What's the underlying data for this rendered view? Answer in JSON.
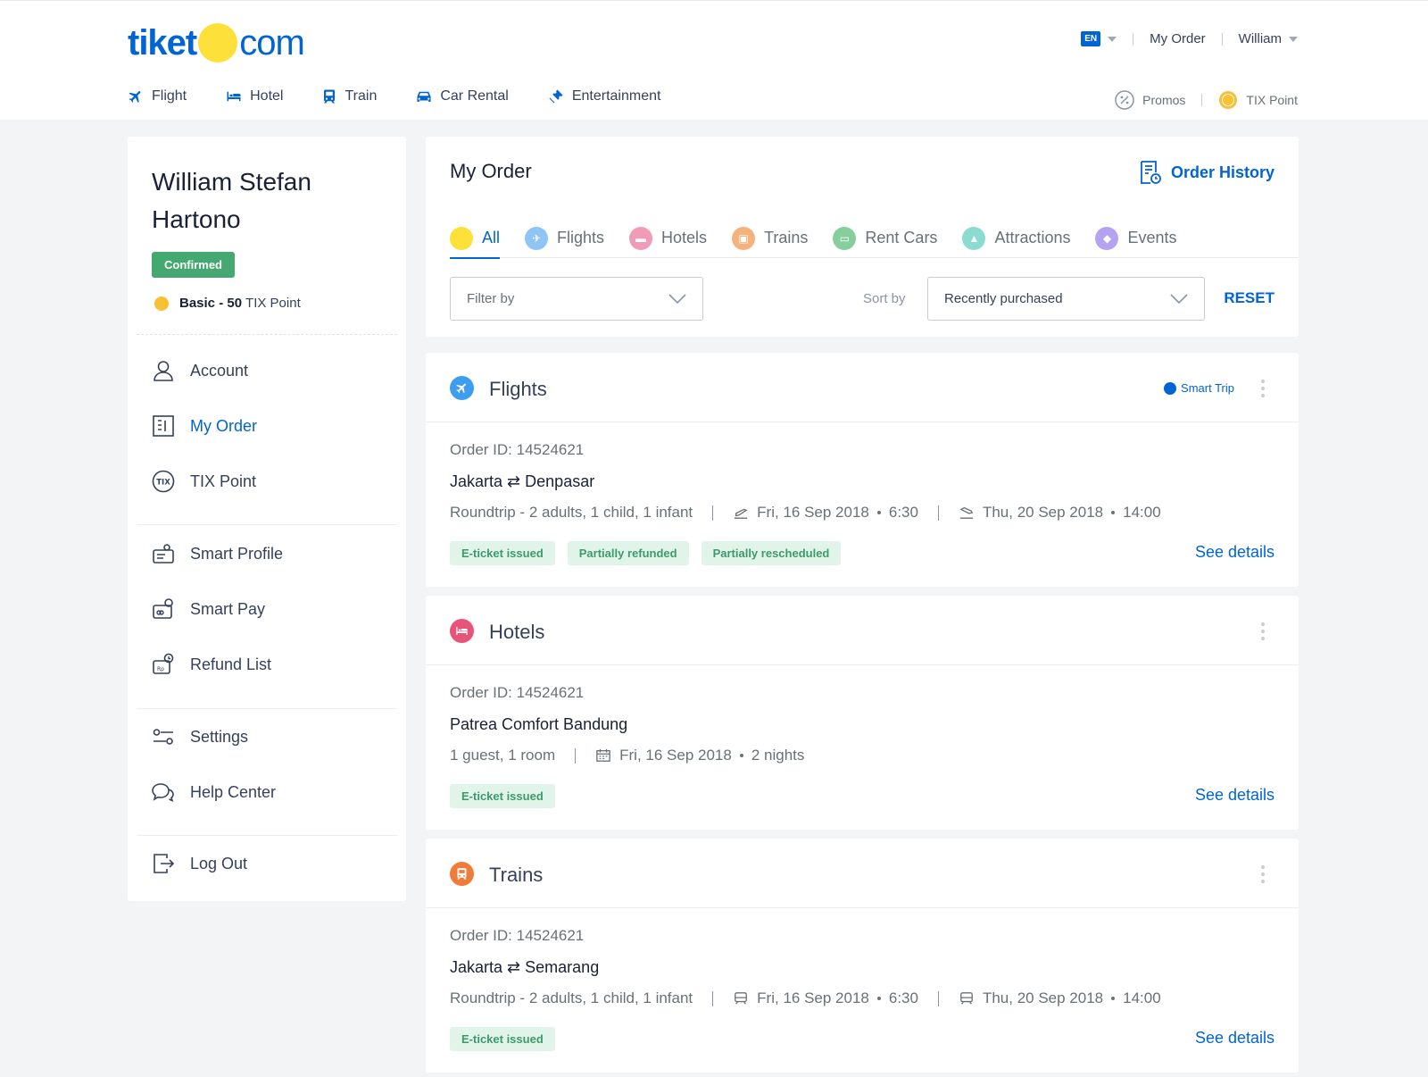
{
  "header": {
    "logo_left": "tiket",
    "logo_right": "com",
    "lang": "EN",
    "my_order": "My Order",
    "user": "William",
    "nav": [
      {
        "label": "Flight",
        "icon": "plane-icon"
      },
      {
        "label": "Hotel",
        "icon": "bed-icon"
      },
      {
        "label": "Train",
        "icon": "train-icon"
      },
      {
        "label": "Car Rental",
        "icon": "car-icon"
      },
      {
        "label": "Entertainment",
        "icon": "ticket-icon"
      }
    ],
    "promos": "Promos",
    "tix_point": "TIX Point"
  },
  "sidebar": {
    "user_name": "William Stefan Hartono",
    "status": "Confirmed",
    "tier_bold": "Basic - 50",
    "tier_rest": "TIX Point",
    "menu": [
      {
        "label": "Account",
        "icon": "user-icon"
      },
      {
        "label": "My Order",
        "icon": "order-list-icon"
      },
      {
        "label": "TIX Point",
        "icon": "tix-icon"
      },
      {
        "label": "Smart Profile",
        "icon": "smart-profile-icon"
      },
      {
        "label": "Smart Pay",
        "icon": "smart-pay-icon"
      },
      {
        "label": "Refund List",
        "icon": "refund-icon"
      },
      {
        "label": "Settings",
        "icon": "settings-icon"
      },
      {
        "label": "Help Center",
        "icon": "chat-icon"
      },
      {
        "label": "Log Out",
        "icon": "logout-icon"
      }
    ]
  },
  "orders": {
    "title": "My Order",
    "history": "Order History",
    "tabs": [
      {
        "label": "All",
        "color": "#fde03a"
      },
      {
        "label": "Flights",
        "color": "#8ec5f4"
      },
      {
        "label": "Hotels",
        "color": "#f29bb6"
      },
      {
        "label": "Trains",
        "color": "#f6b27d"
      },
      {
        "label": "Rent Cars",
        "color": "#86cf9c"
      },
      {
        "label": "Attractions",
        "color": "#8cdbd0"
      },
      {
        "label": "Events",
        "color": "#b5a3f2"
      }
    ],
    "filter_placeholder": "Filter by",
    "sort_label": "Sort by",
    "sort_value": "Recently purchased",
    "reset": "RESET",
    "smart_trip": "Smart Trip",
    "see_details": "See details",
    "cards": [
      {
        "type": "Flights",
        "color": "#3d9ef0",
        "order_id": "Order ID: 14524621",
        "from": "Jakarta",
        "to": "Denpasar",
        "arrow": "⇄",
        "trip": "Roundtrip - 2 adults, 1 child, 1 infant",
        "depart_date": "Fri, 16 Sep 2018",
        "depart_time": "6:30",
        "return_date": "Thu, 20 Sep 2018",
        "return_time": "14:00",
        "badges": [
          "E-ticket issued",
          "Partially refunded",
          "Partially rescheduled"
        ]
      },
      {
        "type": "Hotels",
        "color": "#e8537a",
        "order_id": "Order ID: 14524621",
        "name": "Patrea Comfort Bandung",
        "guests": "1 guest, 1  room",
        "date": "Fri, 16 Sep 2018",
        "nights": "2 nights",
        "badges": [
          "E-ticket issued"
        ]
      },
      {
        "type": "Trains",
        "color": "#f07c3a",
        "order_id": "Order ID: 14524621",
        "from": "Jakarta",
        "to": "Semarang",
        "arrow": "⇄",
        "trip": "Roundtrip - 2 adults, 1 child, 1 infant",
        "depart_date": "Fri, 16 Sep 2018",
        "depart_time": "6:30",
        "return_date": "Thu, 20 Sep 2018",
        "return_time": "14:00",
        "badges": [
          "E-ticket issued"
        ]
      }
    ]
  }
}
